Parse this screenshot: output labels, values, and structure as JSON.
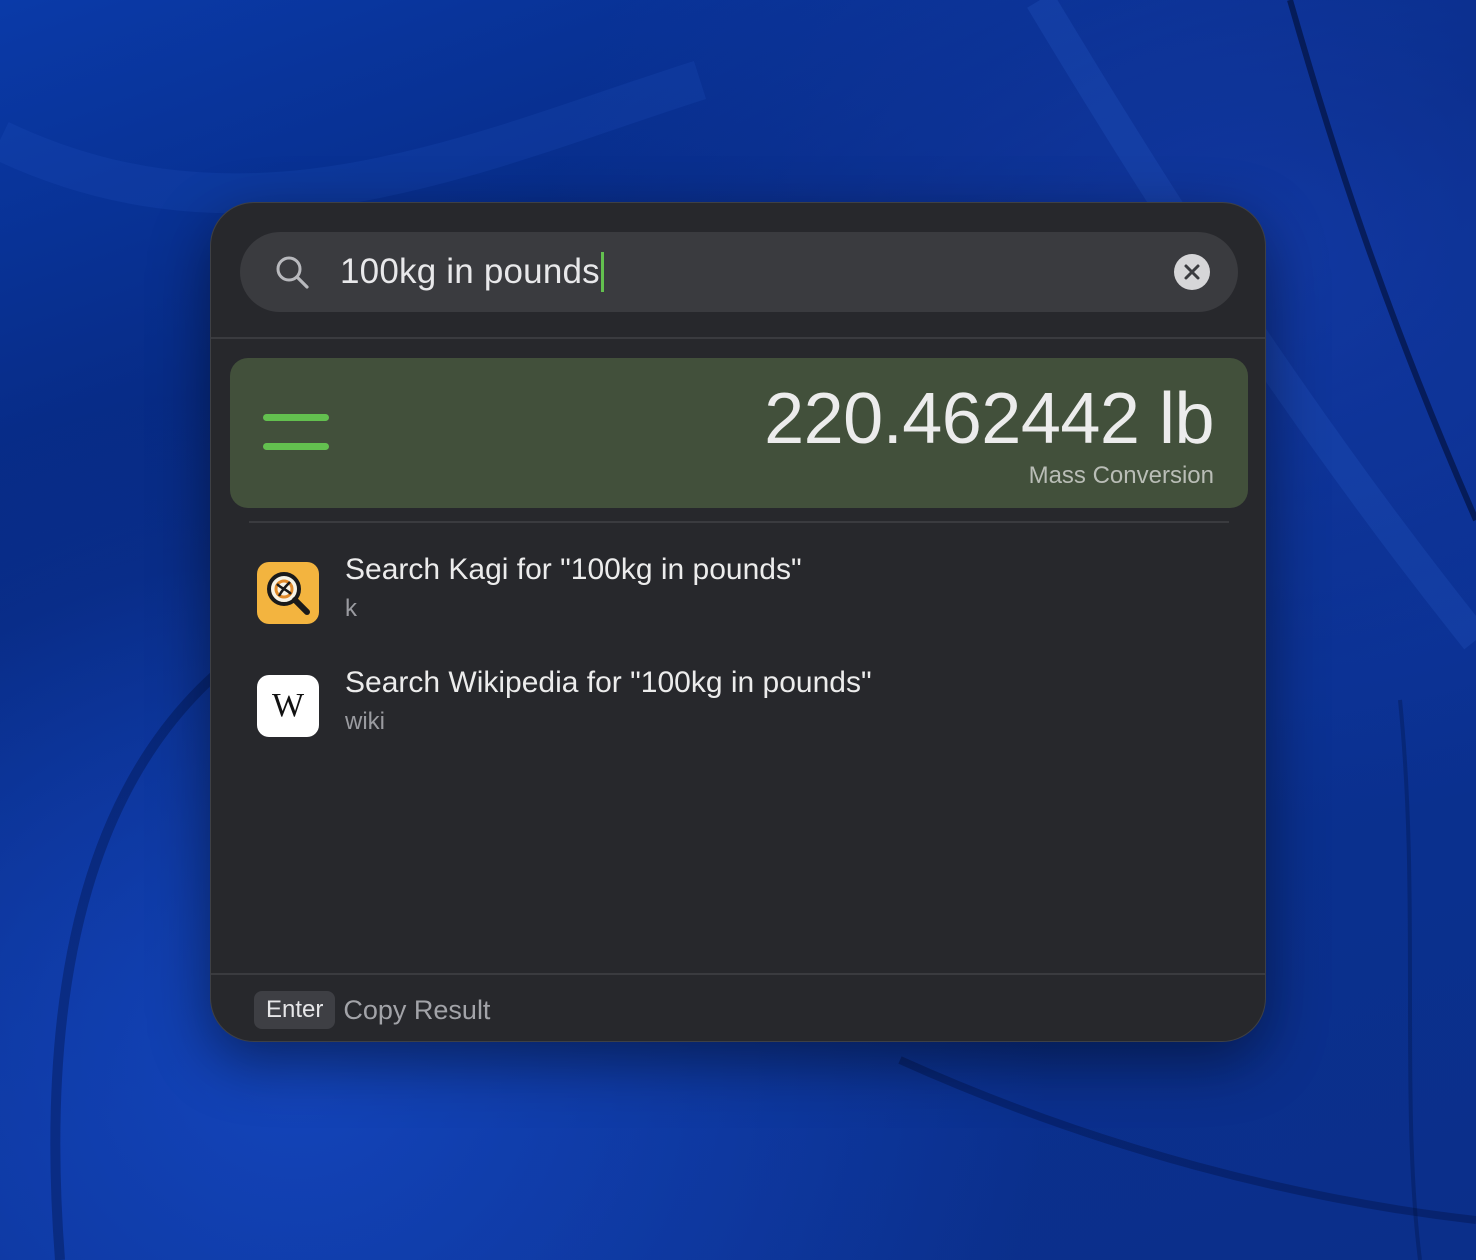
{
  "search": {
    "query": "100kg in pounds"
  },
  "result": {
    "value": "220.462442 lb",
    "subtitle": "Mass Conversion",
    "icon": "equals-icon",
    "accent": "#63c04f",
    "background": "#42503b"
  },
  "items": [
    {
      "title": "Search Kagi for \"100kg in pounds\"",
      "subtitle": "k",
      "icon": "kagi-icon"
    },
    {
      "title": "Search Wikipedia for \"100kg in pounds\"",
      "subtitle": "wiki",
      "icon": "wikipedia-icon",
      "icon_text": "W"
    }
  ],
  "footer": {
    "key": "Enter",
    "action": "Copy Result"
  }
}
